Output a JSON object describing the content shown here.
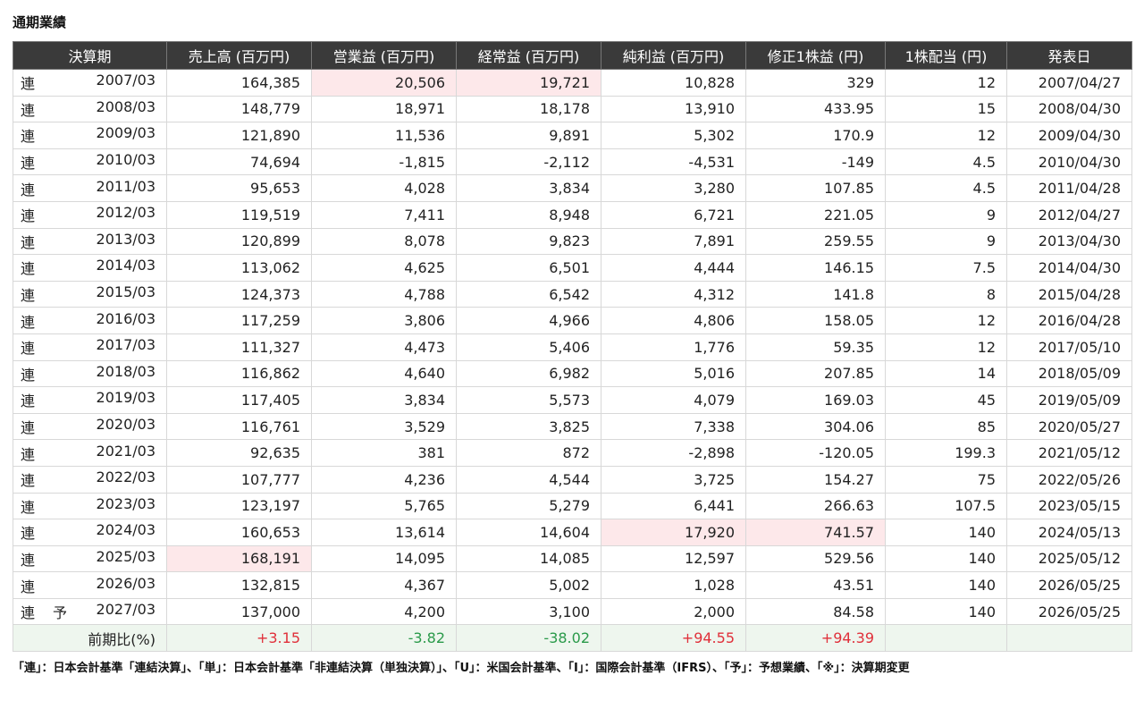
{
  "section_title": "通期業績",
  "headers": [
    "決算期",
    "売上高 (百万円)",
    "営業益 (百万円)",
    "経常益 (百万円)",
    "純利益 (百万円)",
    "修正1株益 (円)",
    "1株配当 (円)",
    "発表日"
  ],
  "rows": [
    {
      "basis": "連",
      "forecast": "",
      "period": "2007/03",
      "sales": "164,385",
      "op": "20,506",
      "ord": "19,721",
      "net": "10,828",
      "eps": "329",
      "div": "12",
      "date": "2007/04/27"
    },
    {
      "basis": "連",
      "forecast": "",
      "period": "2008/03",
      "sales": "148,779",
      "op": "18,971",
      "ord": "18,178",
      "net": "13,910",
      "eps": "433.95",
      "div": "15",
      "date": "2008/04/30"
    },
    {
      "basis": "連",
      "forecast": "",
      "period": "2009/03",
      "sales": "121,890",
      "op": "11,536",
      "ord": "9,891",
      "net": "5,302",
      "eps": "170.9",
      "div": "12",
      "date": "2009/04/30"
    },
    {
      "basis": "連",
      "forecast": "",
      "period": "2010/03",
      "sales": "74,694",
      "op": "-1,815",
      "ord": "-2,112",
      "net": "-4,531",
      "eps": "-149",
      "div": "4.5",
      "date": "2010/04/30"
    },
    {
      "basis": "連",
      "forecast": "",
      "period": "2011/03",
      "sales": "95,653",
      "op": "4,028",
      "ord": "3,834",
      "net": "3,280",
      "eps": "107.85",
      "div": "4.5",
      "date": "2011/04/28"
    },
    {
      "basis": "連",
      "forecast": "",
      "period": "2012/03",
      "sales": "119,519",
      "op": "7,411",
      "ord": "8,948",
      "net": "6,721",
      "eps": "221.05",
      "div": "9",
      "date": "2012/04/27"
    },
    {
      "basis": "連",
      "forecast": "",
      "period": "2013/03",
      "sales": "120,899",
      "op": "8,078",
      "ord": "9,823",
      "net": "7,891",
      "eps": "259.55",
      "div": "9",
      "date": "2013/04/30"
    },
    {
      "basis": "連",
      "forecast": "",
      "period": "2014/03",
      "sales": "113,062",
      "op": "4,625",
      "ord": "6,501",
      "net": "4,444",
      "eps": "146.15",
      "div": "7.5",
      "date": "2014/04/30"
    },
    {
      "basis": "連",
      "forecast": "",
      "period": "2015/03",
      "sales": "124,373",
      "op": "4,788",
      "ord": "6,542",
      "net": "4,312",
      "eps": "141.8",
      "div": "8",
      "date": "2015/04/28"
    },
    {
      "basis": "連",
      "forecast": "",
      "period": "2016/03",
      "sales": "117,259",
      "op": "3,806",
      "ord": "4,966",
      "net": "4,806",
      "eps": "158.05",
      "div": "12",
      "date": "2016/04/28"
    },
    {
      "basis": "連",
      "forecast": "",
      "period": "2017/03",
      "sales": "111,327",
      "op": "4,473",
      "ord": "5,406",
      "net": "1,776",
      "eps": "59.35",
      "div": "12",
      "date": "2017/05/10"
    },
    {
      "basis": "連",
      "forecast": "",
      "period": "2018/03",
      "sales": "116,862",
      "op": "4,640",
      "ord": "6,982",
      "net": "5,016",
      "eps": "207.85",
      "div": "14",
      "date": "2018/05/09"
    },
    {
      "basis": "連",
      "forecast": "",
      "period": "2019/03",
      "sales": "117,405",
      "op": "3,834",
      "ord": "5,573",
      "net": "4,079",
      "eps": "169.03",
      "div": "45",
      "date": "2019/05/09"
    },
    {
      "basis": "連",
      "forecast": "",
      "period": "2020/03",
      "sales": "116,761",
      "op": "3,529",
      "ord": "3,825",
      "net": "7,338",
      "eps": "304.06",
      "div": "85",
      "date": "2020/05/27"
    },
    {
      "basis": "連",
      "forecast": "",
      "period": "2021/03",
      "sales": "92,635",
      "op": "381",
      "ord": "872",
      "net": "-2,898",
      "eps": "-120.05",
      "div": "199.3",
      "date": "2021/05/12"
    },
    {
      "basis": "連",
      "forecast": "",
      "period": "2022/03",
      "sales": "107,777",
      "op": "4,236",
      "ord": "4,544",
      "net": "3,725",
      "eps": "154.27",
      "div": "75",
      "date": "2022/05/26"
    },
    {
      "basis": "連",
      "forecast": "",
      "period": "2023/03",
      "sales": "123,197",
      "op": "5,765",
      "ord": "5,279",
      "net": "6,441",
      "eps": "266.63",
      "div": "107.5",
      "date": "2023/05/15"
    },
    {
      "basis": "連",
      "forecast": "",
      "period": "2024/03",
      "sales": "160,653",
      "op": "13,614",
      "ord": "14,604",
      "net": "17,920",
      "eps": "741.57",
      "div": "140",
      "date": "2024/05/13"
    },
    {
      "basis": "連",
      "forecast": "",
      "period": "2025/03",
      "sales": "168,191",
      "op": "14,095",
      "ord": "14,085",
      "net": "12,597",
      "eps": "529.56",
      "div": "140",
      "date": "2025/05/12"
    },
    {
      "basis": "連",
      "forecast": "",
      "period": "2026/03",
      "sales": "132,815",
      "op": "4,367",
      "ord": "5,002",
      "net": "1,028",
      "eps": "43.51",
      "div": "140",
      "date": "2026/05/25"
    },
    {
      "basis": "連",
      "forecast": "予",
      "period": "2027/03",
      "sales": "137,000",
      "op": "4,200",
      "ord": "3,100",
      "net": "2,000",
      "eps": "84.58",
      "div": "140",
      "date": "2026/05/25"
    }
  ],
  "highlights": {
    "sales": [
      18
    ],
    "op": [
      0
    ],
    "ord": [
      0
    ],
    "net": [
      17
    ],
    "eps": [
      17
    ]
  },
  "ratio": {
    "label": "前期比(%)",
    "sales": "+3.15",
    "op": "-3.82",
    "ord": "-38.02",
    "net": "+94.55",
    "eps": "+94.39",
    "div": "",
    "date": ""
  },
  "colors": {
    "header_bg": "#3a3a3a",
    "highlight": "#fde8ea",
    "ratio_bg": "#eef6ee",
    "positive": "#e0303a",
    "negative": "#2a9a4a"
  },
  "footnote": "「連」：日本会計基準「連結決算」、「単」：日本会計基準「非連結決算（単独決算）」、「U」：米国会計基準、「I」：国際会計基準（IFRS）、「予」：予想業績、「※」：決算期変更"
}
